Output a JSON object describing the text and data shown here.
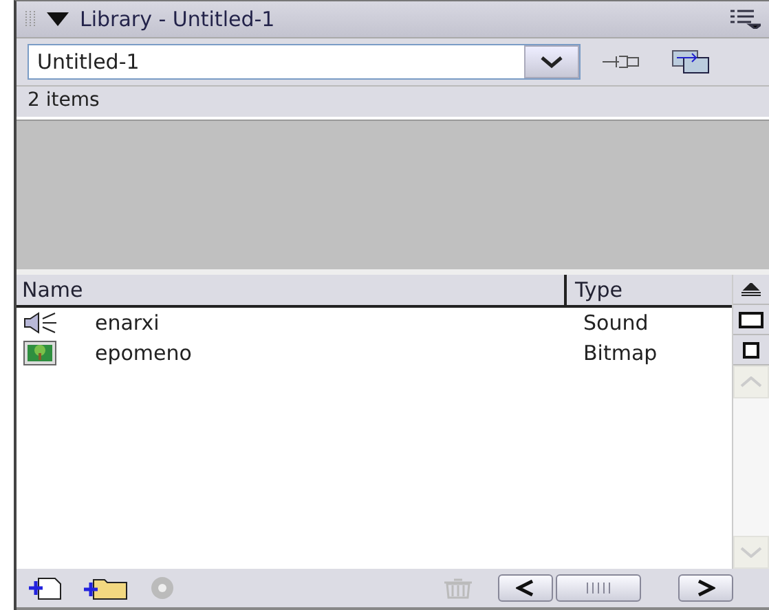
{
  "panel": {
    "title": "Library - Untitled-1",
    "expanded": true
  },
  "document_select": {
    "value": "Untitled-1"
  },
  "item_count": "2 items",
  "columns": [
    {
      "label": "Name"
    },
    {
      "label": "Type"
    }
  ],
  "items": [
    {
      "name": "enarxi",
      "type": "Sound",
      "kind": "sound"
    },
    {
      "name": "epomeno",
      "type": "Bitmap",
      "kind": "bitmap"
    }
  ],
  "footer": {
    "properties_disabled": true,
    "delete_disabled": true
  }
}
